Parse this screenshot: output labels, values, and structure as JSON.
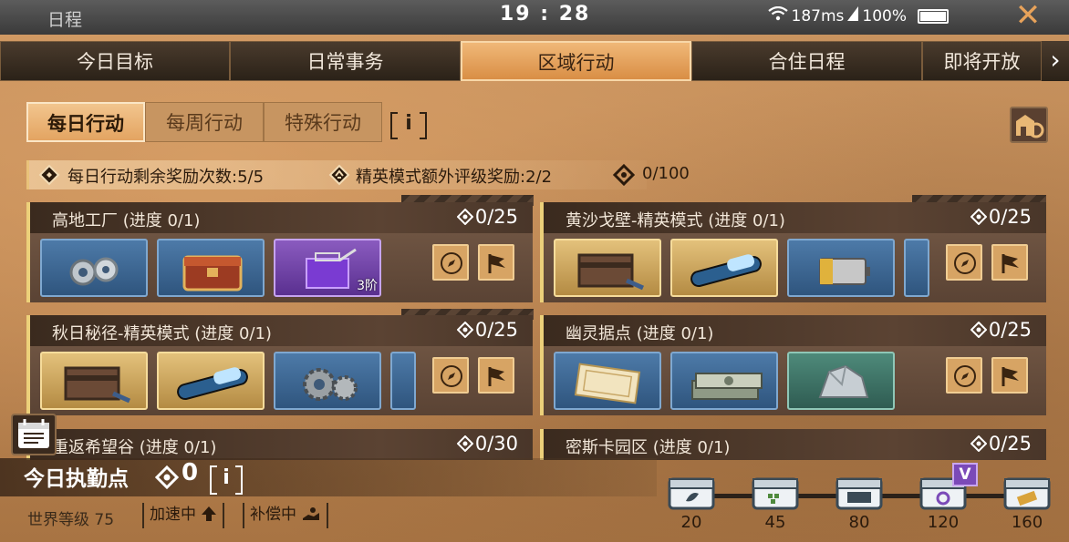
{
  "status_bar": {
    "app_title": "日程",
    "time": "19 : 28",
    "network": "187ms",
    "battery": "100%"
  },
  "tabs": [
    {
      "label": "今日目标",
      "active": false
    },
    {
      "label": "日常事务",
      "active": false
    },
    {
      "label": "区域行动",
      "active": true
    },
    {
      "label": "合住日程",
      "active": false
    },
    {
      "label": "即将开放",
      "active": false
    }
  ],
  "sub_tabs": [
    {
      "label": "每日行动",
      "active": true
    },
    {
      "label": "每周行动",
      "active": false
    },
    {
      "label": "特殊行动",
      "active": false
    }
  ],
  "info_label": "i",
  "summary": {
    "daily_remaining": "每日行动剩余奖励次数:5/5",
    "elite_bonus": "精英模式额外评级奖励:2/2",
    "points": "0/100"
  },
  "cards": [
    {
      "title": "高地工厂 (进度 0/1)",
      "count": "0/25",
      "items": [
        {
          "name": "nuts-bolts-icon",
          "rarity": "blue",
          "badge": ""
        },
        {
          "name": "supply-crate-icon",
          "rarity": "blue",
          "badge": ""
        },
        {
          "name": "purple-toolbox-icon",
          "rarity": "purple",
          "badge": "3阶"
        }
      ]
    },
    {
      "title": "黄沙戈壁-精英模式 (进度 0/1)",
      "count": "0/25",
      "items": [
        {
          "name": "weapon-crate-icon",
          "rarity": "gold",
          "badge": ""
        },
        {
          "name": "syringe-icon",
          "rarity": "gold",
          "badge": ""
        },
        {
          "name": "battery-icon",
          "rarity": "blue",
          "badge": ""
        },
        {
          "name": "partial-item-icon",
          "rarity": "blue",
          "badge": ""
        }
      ]
    },
    {
      "title": "秋日秘径-精英模式 (进度 0/1)",
      "count": "0/25",
      "items": [
        {
          "name": "weapon-crate-icon",
          "rarity": "gold",
          "badge": ""
        },
        {
          "name": "syringe-icon",
          "rarity": "gold",
          "badge": ""
        },
        {
          "name": "gears-icon",
          "rarity": "blue",
          "badge": ""
        },
        {
          "name": "partial-item-icon",
          "rarity": "blue",
          "badge": ""
        }
      ]
    },
    {
      "title": "幽灵据点 (进度 0/1)",
      "count": "0/25",
      "items": [
        {
          "name": "certificate-icon",
          "rarity": "blue",
          "badge": ""
        },
        {
          "name": "cash-stack-icon",
          "rarity": "blue",
          "badge": ""
        },
        {
          "name": "metal-ore-icon",
          "rarity": "green",
          "badge": ""
        }
      ]
    },
    {
      "title": "重返希望谷 (进度 0/1)",
      "count": "0/30",
      "items": []
    },
    {
      "title": "密斯卡园区 (进度 0/1)",
      "count": "0/25",
      "items": []
    }
  ],
  "duty": {
    "title": "今日执勤点",
    "count": "0",
    "info": "i",
    "world_level": "世界等级 75",
    "boost_tag": "加速中",
    "compensation_tag": "补偿中"
  },
  "milestones": [
    {
      "value": "20",
      "icon": "leaf-chest-icon"
    },
    {
      "value": "45",
      "icon": "material-chest-icon"
    },
    {
      "value": "80",
      "icon": "exp-chest-icon"
    },
    {
      "value": "120",
      "icon": "purple-chest-icon",
      "vip": "V"
    },
    {
      "value": "160",
      "icon": "gold-chest-icon"
    }
  ],
  "colors": {
    "accent": "#e3a461",
    "card_header": "#3a2a1e",
    "rarity_blue": "#4d7aa8",
    "rarity_gold": "#e3c17b",
    "rarity_purple": "#8a5bbf"
  }
}
